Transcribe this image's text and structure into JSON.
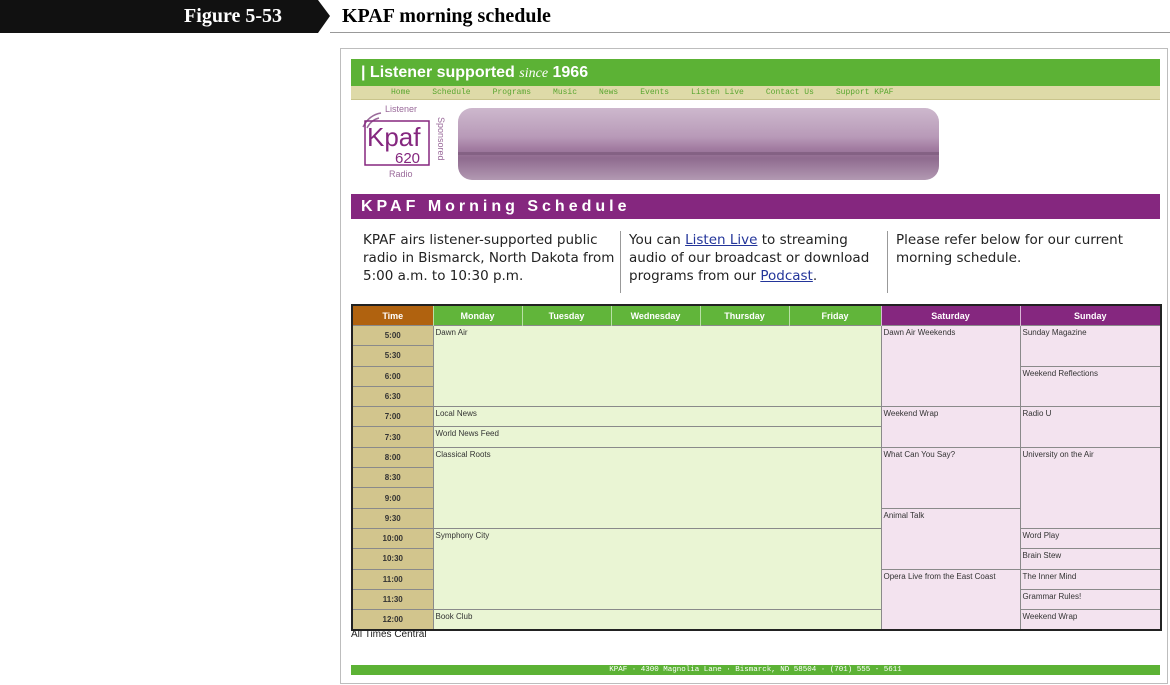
{
  "figure": {
    "label": "Figure 5-53",
    "title": "KPAF morning schedule"
  },
  "banner": {
    "lead": "| Listener supported",
    "since": "since",
    "year": "1966"
  },
  "nav": [
    "Home",
    "Schedule",
    "Programs",
    "Music",
    "News",
    "Events",
    "Listen Live",
    "Contact Us",
    "Support KPAF"
  ],
  "logo": {
    "top": "Listener",
    "name": "Kpaf",
    "frequency": "620",
    "side": "Sponsored",
    "bottom": "Radio"
  },
  "page_title": "KPAF Morning Schedule",
  "intro": {
    "col1": "KPAF airs listener-supported public radio in Bismarck, North Dakota from 5:00 a.m. to 10:30 p.m.",
    "col2_before": "You can",
    "col2_link1": "Listen Live",
    "col2_mid": "to streaming audio of our broadcast or download programs from our",
    "col2_link2": "Podcast",
    "col2_end": ".",
    "col3": "Please refer below for our current morning schedule."
  },
  "table": {
    "headers": [
      "Time",
      "Monday",
      "Tuesday",
      "Wednesday",
      "Thursday",
      "Friday",
      "Saturday",
      "Sunday"
    ],
    "times": [
      "5:00",
      "5:30",
      "6:00",
      "6:30",
      "7:00",
      "7:30",
      "8:00",
      "8:30",
      "9:00",
      "9:30",
      "10:00",
      "10:30",
      "11:00",
      "11:30",
      "12:00"
    ],
    "weekday": [
      "Dawn Air",
      "Local News",
      "World News Feed",
      "Classical Roots",
      "Symphony City",
      "Book Club"
    ],
    "saturday": [
      "Dawn Air Weekends",
      "Weekend Wrap",
      "What Can You Say?",
      "Animal Talk",
      "Opera Live from the East Coast"
    ],
    "sunday": [
      "Sunday Magazine",
      "Weekend Reflections",
      "Radio U",
      "University on the Air",
      "Word Play",
      "Brain Stew",
      "The Inner Mind",
      "Grammar Rules!",
      "Weekend Wrap"
    ]
  },
  "note": "All Times Central",
  "footer": "KPAF · 4300 Magnolia Lane · Bismarck, ND 58504 · (701) 555 - 5611",
  "colors": {
    "green": "#5cb235",
    "purple": "#85277f",
    "time_header": "#b0620f",
    "time_cell": "#d2c58d",
    "weekday_cell": "#eaf5d4",
    "weekend_cell": "#f3e3ef",
    "nav_bg": "#dedaa8"
  }
}
